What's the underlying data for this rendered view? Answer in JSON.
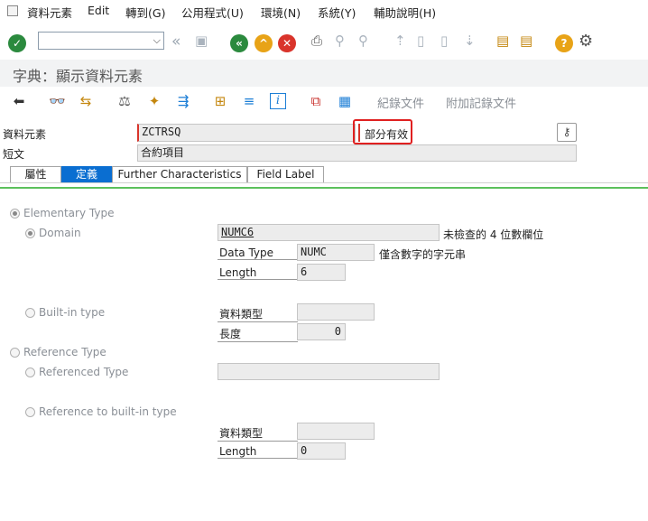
{
  "menu": [
    "資料元素",
    "Edit",
    "轉到(G)",
    "公用程式(U)",
    "環境(N)",
    "系統(Y)",
    "輔助說明(H)"
  ],
  "command_field": {
    "value": ""
  },
  "page_title": "字典：顯示資料元素",
  "app_toolbar": {
    "link1": "紀錄文件",
    "link2": "附加記錄文件"
  },
  "header": {
    "data_element_label": "資料元素",
    "data_element_value": "ZCTRSQ",
    "status": "部分有效",
    "short_text_label": "短文",
    "short_text_value": "合約項目"
  },
  "tabs": [
    "屬性",
    "定義",
    "Further Characteristics",
    "Field Label"
  ],
  "active_tab": "定義",
  "definition": {
    "elementary_type": "Elementary Type",
    "domain": "Domain",
    "domain_value": "NUMC6",
    "domain_desc": "未檢查的 4 位數欄位",
    "data_type_label": "Data Type",
    "data_type_value": "NUMC",
    "data_type_desc": "僅含數字的字元串",
    "length_label": "Length",
    "length_value": "6",
    "builtin_type": "Built-in type",
    "builtin_datatype_label": "資料類型",
    "builtin_datatype_value": "",
    "builtin_length_label": "長度",
    "builtin_length_value": "0",
    "reference_type": "Reference Type",
    "referenced_type": "Referenced Type",
    "referenced_type_value": "",
    "ref_builtin": "Reference to built-in type",
    "ref_datatype_label": "資料類型",
    "ref_datatype_value": "",
    "ref_length_label": "Length",
    "ref_length_value": "0"
  }
}
